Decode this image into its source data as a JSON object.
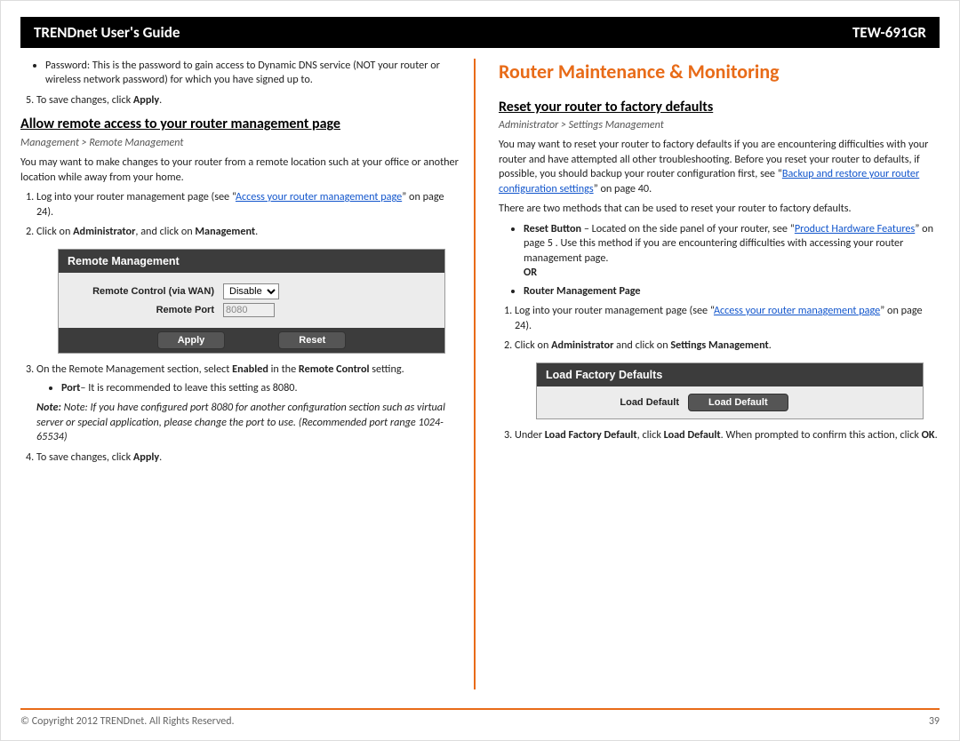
{
  "header": {
    "title_left": "TRENDnet User's Guide",
    "title_right": "TEW-691GR"
  },
  "left": {
    "password_bullet": "Password: This is the password to gain access to Dynamic DNS service (NOT your router or wireless network password) for which you have signed up to.",
    "step5": "To save changes, click ",
    "apply": "Apply",
    "h2": "Allow remote access to your router management page",
    "nav": "Management > Remote Management",
    "intro": "You may want to make changes to your router from a remote location such at your office or another location while away from your home.",
    "s1_a": "Log into your router management page (see “",
    "s1_link": "Access your router management page",
    "s1_b": "” on page 24).",
    "s2_a": "Click on ",
    "s2_admin": "Administrator",
    "s2_b": ", and click on ",
    "s2_mgmt": "Management",
    "ui": {
      "title": "Remote Management",
      "row1_label": "Remote Control (via WAN)",
      "row1_value": "Disable",
      "row2_label": "Remote Port",
      "row2_value": "8080",
      "btn_apply": "Apply",
      "btn_reset": "Reset"
    },
    "s3": "On the Remote Management section, select ",
    "s3_enabled": "Enabled",
    "s3_b": " in the ",
    "s3_rc": "Remote Control",
    "s3_c": " setting.",
    "port_bullet_a": "Port",
    "port_bullet_b": "– It is recommended to leave this setting as 8080.",
    "note": "Note: If you have configured port 8080 for another configuration section such as virtual server or special application, please change the port to use. (Recommended port range 1024-65534)",
    "s4": "To save changes, click ",
    "s4_apply": "Apply"
  },
  "right": {
    "h1": "Router Maintenance & Monitoring",
    "h2": "Reset your router to factory defaults",
    "nav": "Administrator > Settings Management",
    "p1_a": "You may want to reset your router to factory defaults if you are encountering difficulties with your router and have attempted all other troubleshooting. Before you reset your router to defaults, if possible, you should backup your router configuration first, see “",
    "p1_link": "Backup and restore your router configuration settings",
    "p1_b": "” on page 40.",
    "p2": "There are two methods that can be used to reset your router to factory defaults.",
    "reset_btn_label": "Reset Button",
    "reset_btn_text_a": " – Located on the side panel of your router, see “",
    "reset_btn_link": "Product Hardware Features",
    "reset_btn_text_b": "” on page 5 . Use this method if you are encountering difficulties with accessing your router management page.",
    "or": "OR",
    "rmp": "Router Management Page",
    "s1_a": "Log into your router management page (see “",
    "s1_link": "Access your router management page",
    "s1_b": "” on page 24).",
    "s2": "Click on ",
    "s2_admin": "Administrator",
    "s2_b": " and click on ",
    "s2_sm": "Settings Management",
    "ui": {
      "title": "Load Factory Defaults",
      "label": "Load Default",
      "button": "Load Default"
    },
    "s3_a": "Under ",
    "s3_lfd": "Load Factory Default",
    "s3_b": ", click ",
    "s3_ld": "Load Default",
    "s3_c": ". When prompted to confirm this action, click ",
    "s3_ok": "OK",
    "s3_d": "."
  },
  "footer": {
    "copyright": "© Copyright 2012 TRENDnet. All Rights Reserved.",
    "page": "39"
  }
}
